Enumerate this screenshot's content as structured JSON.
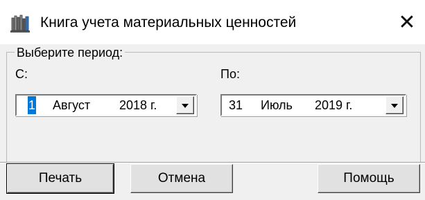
{
  "window": {
    "title": "Книга учета материальных ценностей",
    "icon": "bookshelf-icon",
    "close_glyph": "✕"
  },
  "period_group": {
    "label": "Выберите период:",
    "from": {
      "label": "С:",
      "day": "1",
      "month": "Август",
      "year": "2018 г."
    },
    "to": {
      "label": "По:",
      "day": "31",
      "month": "Июль",
      "year": "2019 г."
    }
  },
  "buttons": {
    "print": "Печать",
    "cancel": "Отмена",
    "help": "Помощь"
  },
  "colors": {
    "selection": "#0078d7",
    "dialog_bg": "#f0f0f0",
    "titlebar_bg": "#ffffff"
  }
}
